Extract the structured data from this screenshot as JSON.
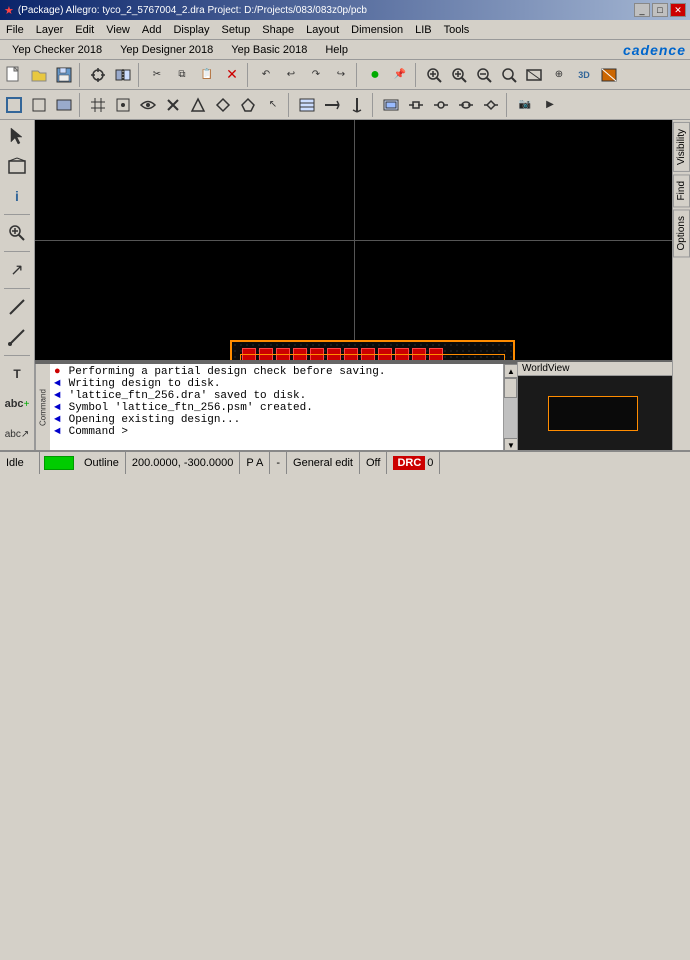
{
  "titleBar": {
    "icon": "★",
    "title": "(Package) Allegro: tyco_2_5767004_2.dra  Project: D:/Projects/083/083z0p/pcb",
    "minimizeLabel": "_",
    "maximizeLabel": "□",
    "closeLabel": "✕"
  },
  "menuBar": {
    "items": [
      "File",
      "Layer",
      "Edit",
      "View",
      "Add",
      "Display",
      "Setup",
      "Shape",
      "Layout",
      "Dimension",
      "LIB",
      "Tools"
    ]
  },
  "yepBar": {
    "items": [
      "Yep Checker 2018",
      "Yep Designer 2018",
      "Yep Basic 2018",
      "Help"
    ],
    "logo": "cadence"
  },
  "rightTabs": {
    "items": [
      "Visibility",
      "Find",
      "Options"
    ]
  },
  "console": {
    "lines": [
      {
        "bullet": "●",
        "text": "Performing a partial design check before saving."
      },
      {
        "bullet": "◄",
        "text": "Writing design to disk."
      },
      {
        "bullet": "◄",
        "text": "'lattice_ftn_256.dra' saved to disk."
      },
      {
        "bullet": "◄",
        "text": "Symbol 'lattice_ftn_256.psm' created."
      },
      {
        "bullet": "◄",
        "text": "Opening existing design..."
      },
      {
        "bullet": "◄",
        "text": "Command >"
      }
    ],
    "sideLabel": "Command"
  },
  "worldView": {
    "label": "WorldView"
  },
  "statusBar": {
    "idle": "Idle",
    "outline": "Outline",
    "coords": "200.0000, -300.0000",
    "pa": "P  A",
    "dash": "-",
    "generalEdit": "General edit",
    "off": "Off",
    "drc": "DRC",
    "drcCount": "0"
  }
}
